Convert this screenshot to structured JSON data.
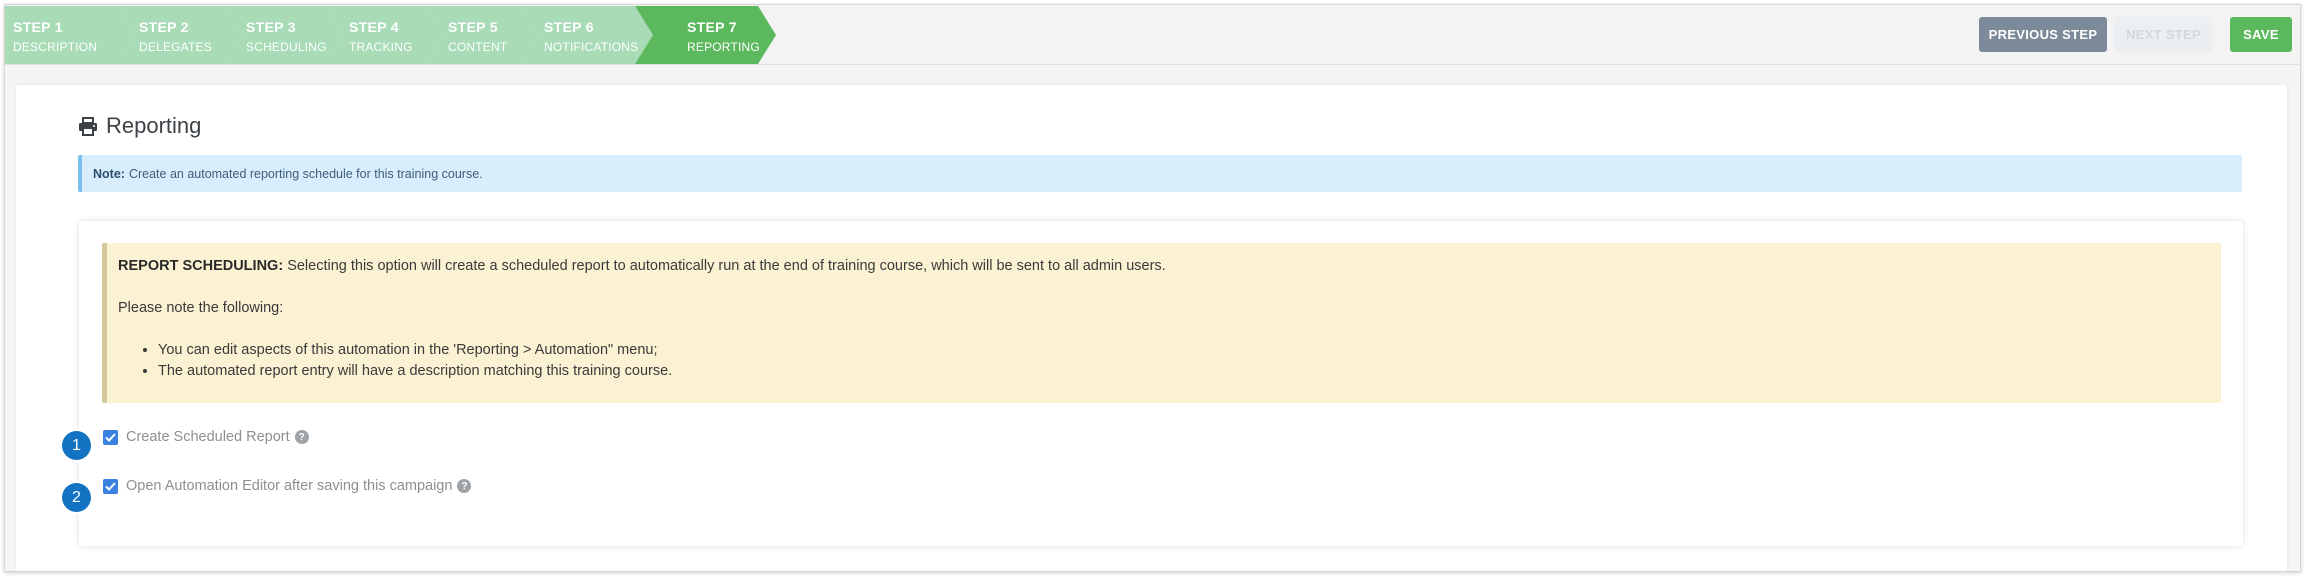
{
  "wizard": {
    "steps": [
      {
        "num": "STEP 1",
        "label": "DESCRIPTION"
      },
      {
        "num": "STEP 2",
        "label": "DELEGATES"
      },
      {
        "num": "STEP 3",
        "label": "SCHEDULING"
      },
      {
        "num": "STEP 4",
        "label": "TRACKING"
      },
      {
        "num": "STEP 5",
        "label": "CONTENT"
      },
      {
        "num": "STEP 6",
        "label": "NOTIFICATIONS"
      },
      {
        "num": "STEP 7",
        "label": "REPORTING"
      }
    ],
    "previous_label": "PREVIOUS STEP",
    "next_label": "NEXT STEP",
    "save_label": "SAVE"
  },
  "page": {
    "title": "Reporting",
    "title_icon": "printer-icon"
  },
  "note": {
    "label": "Note:",
    "text": "Create an automated reporting schedule for this training course."
  },
  "scheduling_info": {
    "heading": "REPORT SCHEDULING:",
    "text": "Selecting this option will create a scheduled report to automatically run at the end of training course, which will be sent to all admin users.",
    "intro": "Please note the following:",
    "items": [
      "You can edit aspects of this automation in the 'Reporting > Automation\" menu;",
      "The automated report entry will have a description matching this training course."
    ]
  },
  "options": [
    {
      "badge": "1",
      "label": "Create Scheduled Report",
      "checked": true,
      "help": "?"
    },
    {
      "badge": "2",
      "label": "Open Automation Editor after saving this campaign",
      "checked": true,
      "help": "?"
    }
  ],
  "colors": {
    "step_done": "#a8dbb6",
    "step_active": "#5cb85c",
    "badge": "#1373c2",
    "checkbox": "#3b82e0"
  }
}
